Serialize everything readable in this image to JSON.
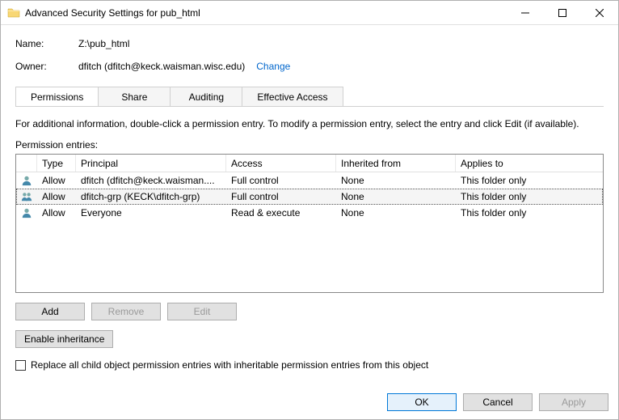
{
  "window": {
    "title": "Advanced Security Settings for pub_html"
  },
  "info": {
    "name_label": "Name:",
    "name_value": "Z:\\pub_html",
    "owner_label": "Owner:",
    "owner_value": "dfitch (dfitch@keck.waisman.wisc.edu)",
    "change_link": "Change"
  },
  "tabs": {
    "permissions": "Permissions",
    "share": "Share",
    "auditing": "Auditing",
    "effective": "Effective Access",
    "active": "permissions"
  },
  "body": {
    "description": "For additional information, double-click a permission entry. To modify a permission entry, select the entry and click Edit (if available).",
    "entries_label": "Permission entries:"
  },
  "table": {
    "headers": {
      "type": "Type",
      "principal": "Principal",
      "access": "Access",
      "inherited": "Inherited from",
      "applies": "Applies to"
    },
    "rows": [
      {
        "icon": "user",
        "type": "Allow",
        "principal": "dfitch (dfitch@keck.waisman....",
        "access": "Full control",
        "inherited": "None",
        "applies": "This folder only",
        "selected": false
      },
      {
        "icon": "group",
        "type": "Allow",
        "principal": "dfitch-grp (KECK\\dfitch-grp)",
        "access": "Full control",
        "inherited": "None",
        "applies": "This folder only",
        "selected": true
      },
      {
        "icon": "user",
        "type": "Allow",
        "principal": "Everyone",
        "access": "Read & execute",
        "inherited": "None",
        "applies": "This folder only",
        "selected": false
      }
    ]
  },
  "buttons": {
    "add": "Add",
    "remove": "Remove",
    "edit": "Edit",
    "enable_inheritance": "Enable inheritance",
    "ok": "OK",
    "cancel": "Cancel",
    "apply": "Apply"
  },
  "checkbox": {
    "label": "Replace all child object permission entries with inheritable permission entries from this object",
    "checked": false
  }
}
